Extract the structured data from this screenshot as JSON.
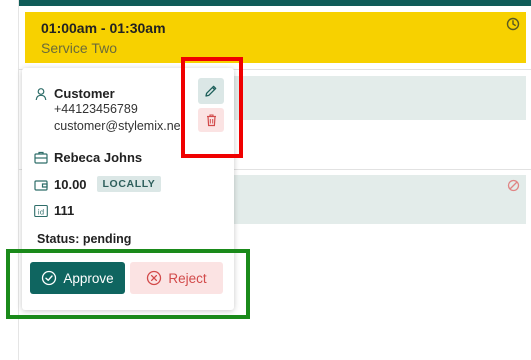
{
  "booking": {
    "time": "01:00am - 01:30am",
    "service": "Service Two",
    "color": "#f7d100",
    "icon": "clock-icon"
  },
  "popover": {
    "customer_name": "Customer",
    "phone": "+44123456789",
    "email": "customer@stylemix.ne",
    "employee": "Rebeca Johns",
    "price": "10.00",
    "payment_badge": "LOCALLY",
    "booking_id": "111",
    "status": "Status: pending",
    "actions": {
      "edit_icon": "pencil-icon",
      "delete_icon": "trash-icon"
    },
    "approve_label": "Approve",
    "reject_label": "Reject"
  },
  "colors": {
    "primary": "#0f6560",
    "danger": "#d24a4a",
    "highlight_red": "#f00000",
    "highlight_green": "#1a8a1a"
  }
}
